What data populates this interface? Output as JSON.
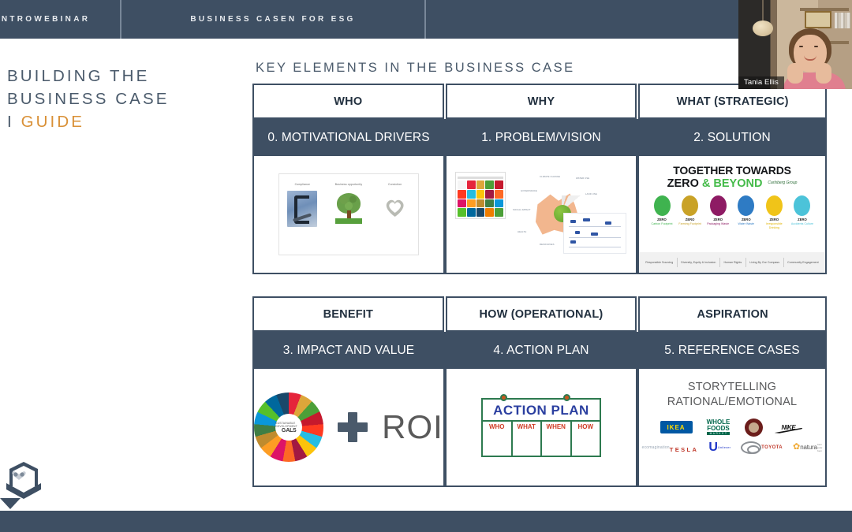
{
  "topbar": {
    "segments": [
      {
        "label": "INTROWEBINAR"
      },
      {
        "label": "BUSINESS CASEN FOR ESG"
      },
      {
        "label": ""
      }
    ]
  },
  "slide": {
    "left_title": {
      "line1": "BUILDING THE",
      "line2": "BUSINESS CASE",
      "line3_prefix": "I ",
      "line3_accent": "GUIDE"
    },
    "heading": "KEY ELEMENTS IN THE BUSINESS CASE",
    "tables": [
      {
        "headers": [
          "WHO",
          "WHY",
          "WHAT (STRATEGIC)"
        ],
        "subheaders": [
          "0. MOTIVATIONAL DRIVERS",
          "1. PROBLEM/VISION",
          "2. SOLUTION"
        ]
      },
      {
        "headers": [
          "BENEFIT",
          "HOW (OPERATIONAL)",
          "ASPIRATION"
        ],
        "subheaders": [
          "3. IMPACT AND VALUE",
          "4. ACTION PLAN",
          "5. REFERENCE CASES"
        ]
      }
    ],
    "cell_drivers": {
      "items": [
        "Compliance",
        "Business opportunity",
        "Conviction"
      ]
    },
    "cell_vision": {
      "radial_labels": [
        "CLIMATE CHANGE",
        "WATER USE",
        "LAND USE",
        "BIODIVERSITY",
        "AIR QUALITY",
        "RESOURCES",
        "HEALTH",
        "SOCIAL IMPACT",
        "GOVERNANCE"
      ]
    },
    "cell_solution": {
      "title_line1": "TOGETHER TOWARDS",
      "title_zero": "ZERO",
      "title_beyond": "& BEYOND",
      "brand": "Carlsberg Group",
      "pillars": [
        {
          "tag": "ZERO",
          "label": "Carbon Footprint",
          "color": "#3fb34f"
        },
        {
          "tag": "ZERO",
          "label": "Farming Footprint",
          "color": "#c9a227"
        },
        {
          "tag": "ZERO",
          "label": "Packaging Waste",
          "color": "#8e1b64"
        },
        {
          "tag": "ZERO",
          "label": "Water Waste",
          "color": "#2e7bc4"
        },
        {
          "tag": "ZERO",
          "label": "Irresponsible Drinking",
          "color": "#f0c419"
        },
        {
          "tag": "ZERO",
          "label": "Accidents Culture",
          "color": "#4cc3d9"
        }
      ],
      "footer_items": [
        "Responsible Sourcing",
        "Diversity, Equity & Inclusion",
        "Human Rights",
        "Living By Our Compass",
        "Community Engagement"
      ]
    },
    "cell_impact": {
      "wheel_center_small": "SUSTAINABLE DEVELOPMENT",
      "wheel_center_big": "G ALS",
      "plus": "+",
      "roi": "ROI"
    },
    "cell_action": {
      "title": "ACTION PLAN",
      "columns": [
        "WHO",
        "WHAT",
        "WHEN",
        "HOW"
      ]
    },
    "cell_reference": {
      "title_line1": "STORYTELLING",
      "title_line2": "RATIONAL/EMOTIONAL",
      "logos_row1": [
        "IKEA",
        "WHOLE FOODS MARKET",
        "STARBUCKS",
        "NIKE"
      ],
      "logos_row2": [
        "ecomagination / TESLA",
        "Unilever",
        "TOYOTA",
        "natura"
      ],
      "logo_text": {
        "ikea": "IKEA",
        "wf_a": "WHOLE",
        "wf_b": "FOODS",
        "wf_c": "M A R K E T",
        "nike": "NIKE",
        "eco": "ecomagination",
        "tesla": "TESLA",
        "unilever_u": "U",
        "unilever_n": "Unilever",
        "toyota": "TOYOTA",
        "natura": "natura",
        "natura_sub": "bem estar bem"
      }
    }
  },
  "video": {
    "participant_name": "Tania Ellis"
  },
  "colors": {
    "dark_blue": "#3e4f63",
    "accent_orange": "#d99036",
    "title_grey": "#4a5a6b"
  }
}
